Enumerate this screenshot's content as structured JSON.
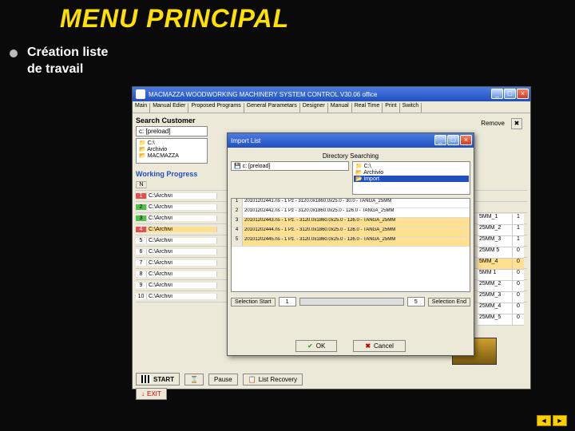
{
  "slide": {
    "title": "MENU PRINCIPAL",
    "caption": "Création liste de travail"
  },
  "mainwin": {
    "title": "MACMAZZA WOODWORKING MACHINERY SYSTEM CONTROL  V30.06 office",
    "tabs": [
      "Main",
      "Manual Edier",
      "Proposed Programs",
      "General Parametars",
      "Designer",
      "Manual",
      "Real Time",
      "Print",
      "Switch"
    ],
    "search_label": "Search Customer",
    "drive": "c: [preload]",
    "remove": "Remove",
    "tree": [
      "C:\\",
      "Archivio",
      "MACMAZZA"
    ],
    "wp_label": "Working Progress",
    "wp_header": "N",
    "wp": [
      {
        "n": "1",
        "p": "C:\\Archivi"
      },
      {
        "n": "2",
        "p": "C:\\Archivi"
      },
      {
        "n": "3",
        "p": "C:\\Archivi"
      },
      {
        "n": "4",
        "p": "C:\\Archivi"
      },
      {
        "n": "5",
        "p": "C:\\Archivi"
      },
      {
        "n": "6",
        "p": "C:\\Archivi"
      },
      {
        "n": "7",
        "p": "C:\\Archivi"
      },
      {
        "n": "8",
        "p": "C:\\Archivi"
      },
      {
        "n": "9",
        "p": "C:\\Archivi"
      },
      {
        "n": "10",
        "p": "C:\\Archivi"
      }
    ],
    "side": [
      {
        "t": "5MM_1",
        "v": "1"
      },
      {
        "t": "25MM_2",
        "v": "1"
      },
      {
        "t": "25MM_3",
        "v": "1"
      },
      {
        "t": "25MM 5",
        "v": "0"
      },
      {
        "t": "5MM_4",
        "v": "0"
      },
      {
        "t": "5MM 1",
        "v": "0"
      },
      {
        "t": "25MM_2",
        "v": "0"
      },
      {
        "t": "25MM_3",
        "v": "0"
      },
      {
        "t": "25MM_4",
        "v": "0"
      },
      {
        "t": "25MM_5",
        "v": "0"
      }
    ],
    "start": "START",
    "exit": "EXIT",
    "pause": "Pause",
    "listrec": "List Recovery"
  },
  "modal": {
    "title": "Import List",
    "dirsearch": "Directory Searching",
    "drive": "c: [preload]",
    "treeL": [
      "C:\\",
      "Archivio",
      "import"
    ],
    "treeR": [
      "C:\\",
      "Archivio",
      "import"
    ],
    "rows": [
      {
        "n": "1",
        "t": "20101202441.ris - 1 Pz - 3120.0x1860.0x25.0 - 30.0 - TANGA_25MM"
      },
      {
        "n": "2",
        "t": "20101202442.ris - 1 Pz - 3120.0x1860.0x25.0 - 126.0 - TANGA_25MM"
      },
      {
        "n": "3",
        "t": "20101202443.ns - 1 Pz. - 3120.0x1860.0x25.0 - 126.0 - TANGA_25MM"
      },
      {
        "n": "4",
        "t": "20101202444.ns - 1 Pz. - 3120.0x1860.0x25.0 - 126.0 - TANGA_25MM"
      },
      {
        "n": "5",
        "t": "20101202445.ns - 1 Pz. - 3120.0x1860.0x25.0 - 126.0 - TANGA_25MM"
      }
    ],
    "selstart": "Selection Start",
    "selend": "Selection End",
    "v1": "1",
    "v2": "5",
    "ok": "OK",
    "cancel": "Cancel"
  }
}
